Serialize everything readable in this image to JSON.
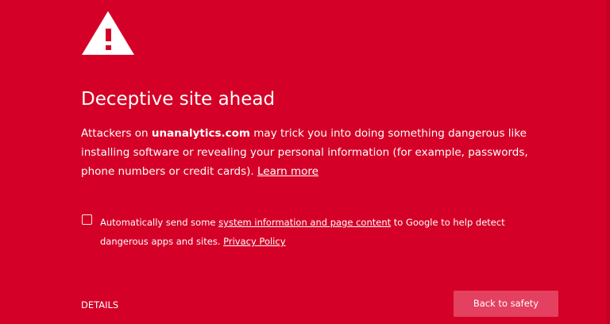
{
  "colors": {
    "background": "#d50027",
    "button_background": "#e44060",
    "text": "#ffffff"
  },
  "icon": {
    "name": "warning-icon"
  },
  "warning": {
    "title": "Deceptive site ahead",
    "body_prefix": "Attackers on ",
    "domain": "unanalytics.com",
    "body_suffix": " may trick you into doing something dangerous like installing software or revealing your personal information (for example, passwords, phone numbers or credit cards). ",
    "learn_more": "Learn more"
  },
  "reporting": {
    "checked": false,
    "prefix": "Automatically send some ",
    "link": "system information and page content",
    "middle": " to Google to help detect dangerous apps and sites. ",
    "privacy_policy": "Privacy Policy"
  },
  "actions": {
    "details": "DETAILS",
    "back_to_safety": "Back to safety"
  }
}
